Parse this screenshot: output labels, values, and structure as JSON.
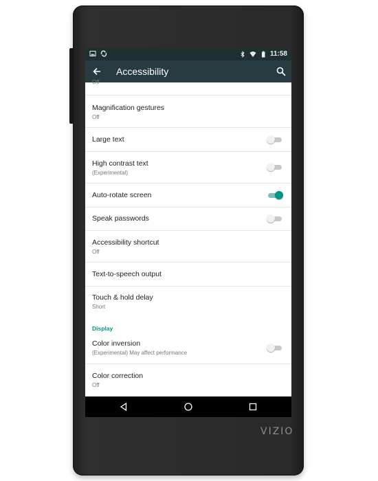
{
  "status_bar": {
    "time": "11:58"
  },
  "app_bar": {
    "title": "Accessibility"
  },
  "clipped_item": {
    "summary": "Off"
  },
  "settings": [
    {
      "title": "Magnification gestures",
      "summary": "Off"
    },
    {
      "title": "Large text",
      "toggle": false
    },
    {
      "title": "High contrast text",
      "summary": "(Experimental)",
      "toggle": false
    },
    {
      "title": "Auto-rotate screen",
      "toggle": true
    },
    {
      "title": "Speak passwords",
      "toggle": false
    },
    {
      "title": "Accessibility shortcut",
      "summary": "Off"
    },
    {
      "title": "Text-to-speech output"
    },
    {
      "title": "Touch & hold delay",
      "summary": "Short"
    }
  ],
  "display_section": {
    "header": "Display",
    "items": [
      {
        "title": "Color inversion",
        "summary": "(Experimental) May affect performance",
        "toggle": false
      },
      {
        "title": "Color correction",
        "summary": "Off"
      }
    ]
  },
  "brand": "VIZIO",
  "colors": {
    "accent": "#009688",
    "toolbar": "#263c40",
    "statusbar": "#1f3033"
  }
}
